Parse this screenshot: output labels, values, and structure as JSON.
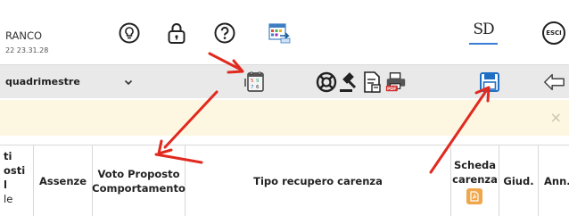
{
  "header": {
    "user_name": "RANCO",
    "user_time": "22 23.31.28",
    "logo_text": "SD",
    "exit_label": "ESCI"
  },
  "toolbar": {
    "period_select": "quadrimestre"
  },
  "notice": {
    "close_glyph": "×"
  },
  "table": {
    "cut_col": [
      "ti",
      "osti",
      "l",
      "le"
    ],
    "columns": {
      "assenze": "Assenze",
      "voto_line1": "Voto Proposto",
      "voto_line2": "Comportamento",
      "tipo_recupero": "Tipo recupero carenza",
      "scheda_line1": "Scheda",
      "scheda_line2": "carenza",
      "giud": "Giud.",
      "ann": "Ann."
    }
  },
  "colors": {
    "toolbar_bg": "#e9e9e9",
    "notice_bg": "#fdf7e2",
    "annotation_arrow": "#e02a1f",
    "save_icon": "#1f6fc4",
    "pdf_badge": "#f0a64a"
  },
  "icons": [
    "lightbulb-icon",
    "lock-icon",
    "help-icon",
    "calendar-icon",
    "calendar-grades-icon",
    "lifebuoy-icon",
    "gavel-icon",
    "document-icon",
    "print-pdf-icon",
    "save-icon",
    "back-arrow-icon",
    "close-icon",
    "pdf-icon"
  ]
}
